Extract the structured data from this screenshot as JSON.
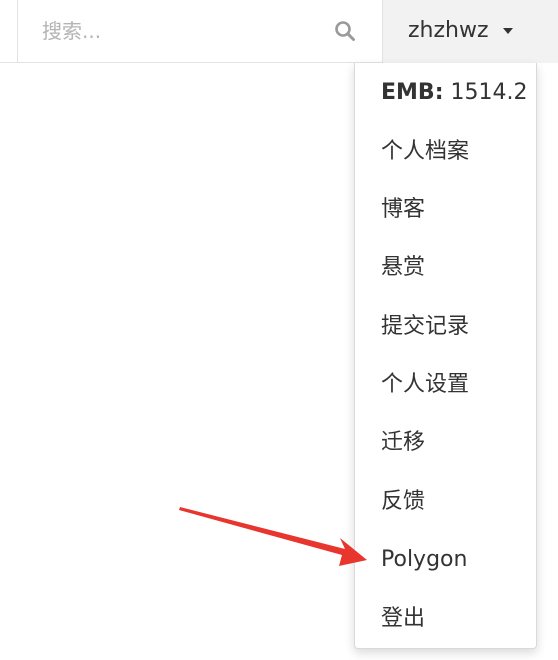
{
  "search": {
    "placeholder": "搜索..."
  },
  "user": {
    "name": "zhzhwz"
  },
  "menu": {
    "emb_label": "EMB:",
    "emb_value": "1514.2",
    "items": [
      {
        "label": "个人档案"
      },
      {
        "label": "博客"
      },
      {
        "label": "悬赏"
      },
      {
        "label": "提交记录"
      },
      {
        "label": "个人设置"
      },
      {
        "label": "迁移"
      },
      {
        "label": "反馈"
      },
      {
        "label": "Polygon"
      },
      {
        "label": "登出"
      }
    ]
  },
  "colors": {
    "annotation_arrow": "#e8352e",
    "dropdown_toggle_bg": "#f2f2f2"
  }
}
